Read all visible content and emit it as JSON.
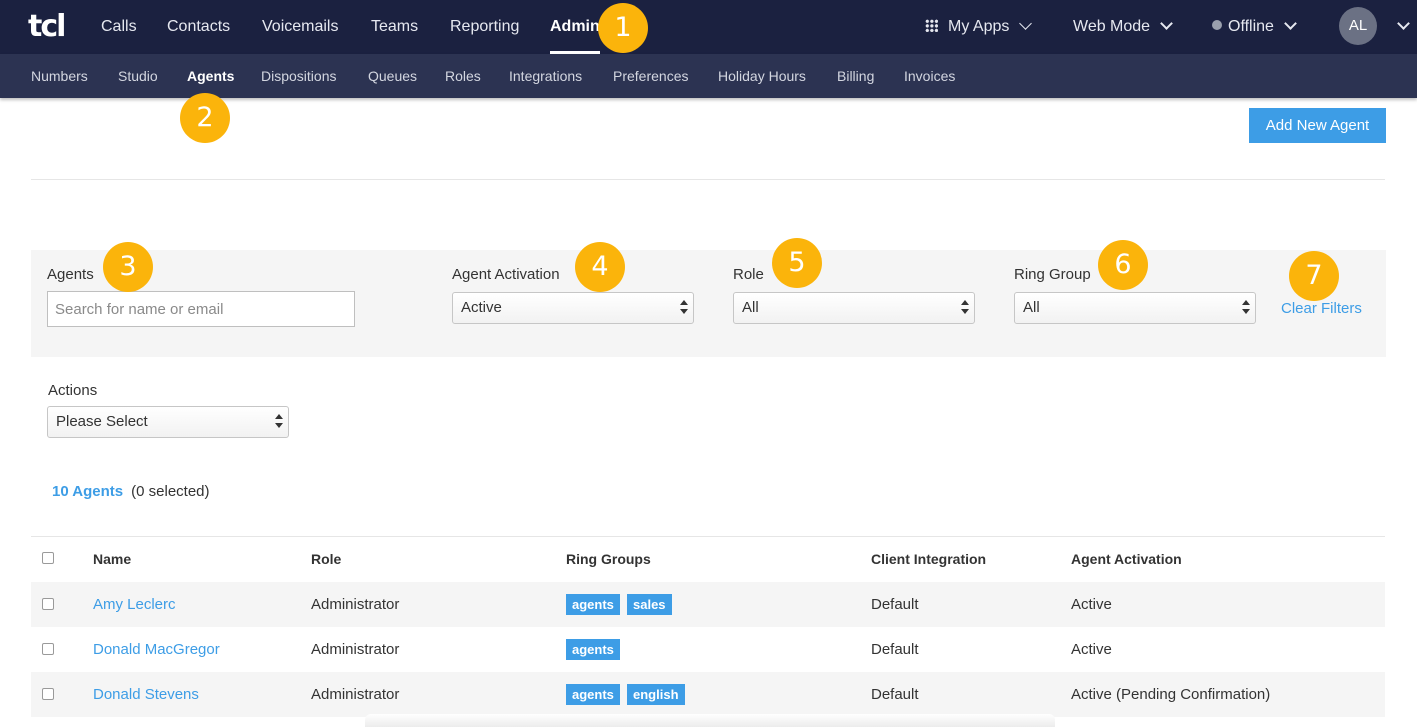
{
  "header": {
    "logo": "tcl",
    "nav": [
      "Calls",
      "Contacts",
      "Voicemails",
      "Teams",
      "Reporting",
      "Admin"
    ],
    "my_apps": "My Apps",
    "web_mode": "Web Mode",
    "status": "Offline",
    "avatar": "AL"
  },
  "subnav": [
    "Numbers",
    "Studio",
    "Agents",
    "Dispositions",
    "Queues",
    "Roles",
    "Integrations",
    "Preferences",
    "Holiday Hours",
    "Billing",
    "Invoices"
  ],
  "callouts": [
    "1",
    "2",
    "3",
    "4",
    "5",
    "6",
    "7"
  ],
  "add_button": "Add New Agent",
  "filters": {
    "agents_label": "Agents",
    "search_placeholder": "Search for name or email",
    "activation_label": "Agent Activation",
    "activation_value": "Active",
    "role_label": "Role",
    "role_value": "All",
    "ring_group_label": "Ring Group",
    "ring_group_value": "All",
    "clear": "Clear Filters"
  },
  "actions": {
    "label": "Actions",
    "value": "Please Select"
  },
  "summary": {
    "count": "10 Agents",
    "selected": "(0 selected)"
  },
  "table": {
    "headers": [
      "Name",
      "Role",
      "Ring Groups",
      "Client Integration",
      "Agent Activation"
    ],
    "rows": [
      {
        "name": "Amy Leclerc",
        "role": "Administrator",
        "groups": [
          "agents",
          "sales"
        ],
        "integration": "Default",
        "activation": "Active"
      },
      {
        "name": "Donald MacGregor",
        "role": "Administrator",
        "groups": [
          "agents"
        ],
        "integration": "Default",
        "activation": "Active"
      },
      {
        "name": "Donald Stevens",
        "role": "Administrator",
        "groups": [
          "agents",
          "english"
        ],
        "integration": "Default",
        "activation": "Active (Pending Confirmation)"
      }
    ]
  },
  "colors": {
    "topbar": "#1b2140",
    "subbar": "#2c3352",
    "accent": "#3d9de6",
    "callout": "#fbb40b"
  }
}
